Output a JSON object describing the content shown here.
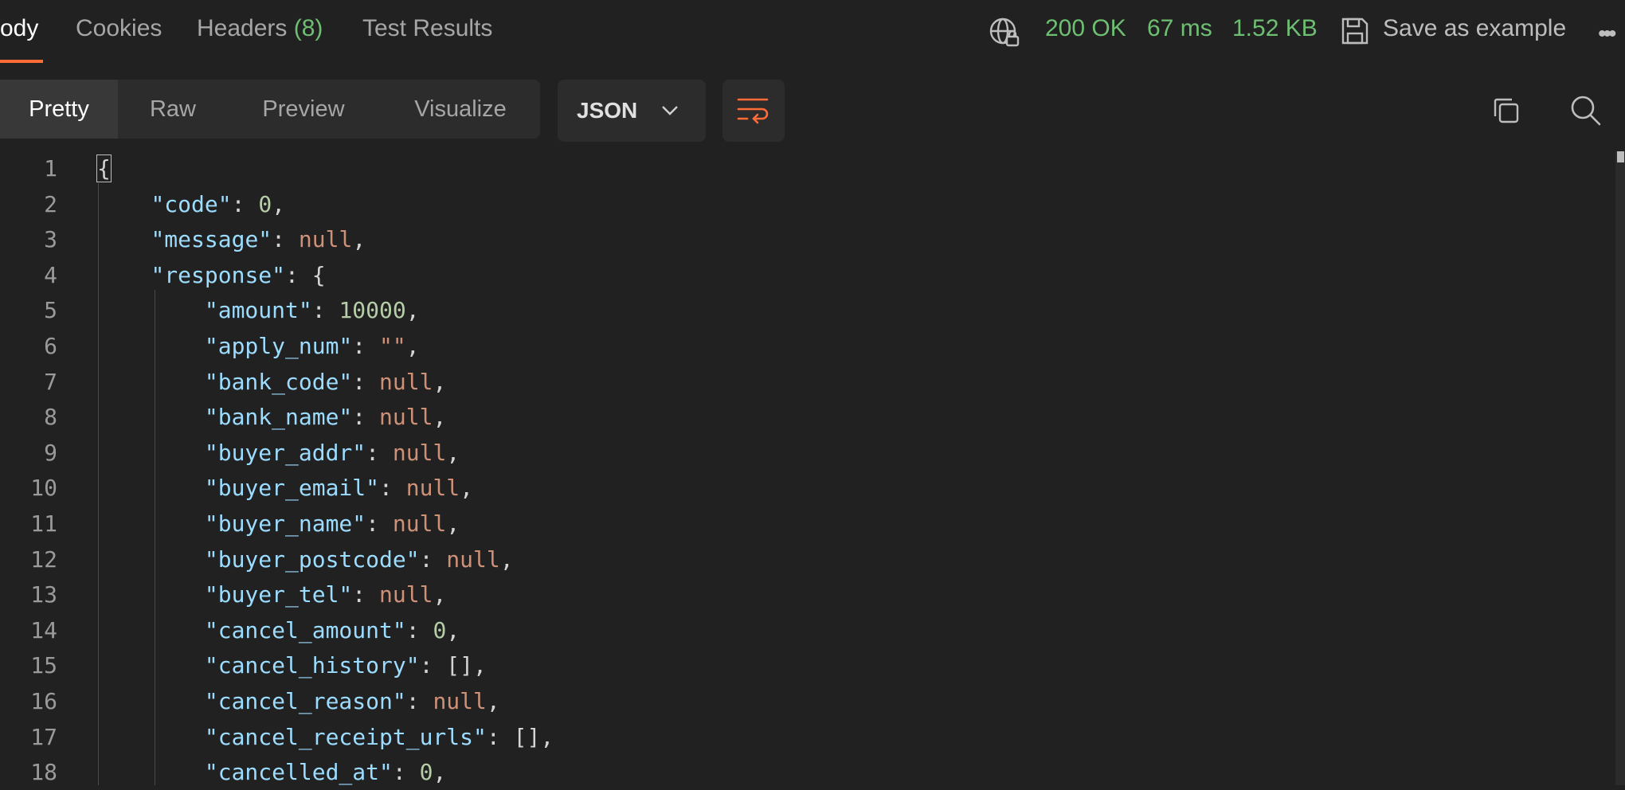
{
  "tabs": [
    {
      "label": "ody",
      "active": true
    },
    {
      "label": "Cookies"
    },
    {
      "label": "Headers",
      "count": "(8)"
    },
    {
      "label": "Test Results"
    }
  ],
  "status": {
    "code": "200 OK",
    "time": "67 ms",
    "size": "1.52 KB"
  },
  "save_example_label": "Save as example",
  "more_label": "•••",
  "view_modes": [
    "Pretty",
    "Raw",
    "Preview",
    "Visualize"
  ],
  "format": "JSON",
  "colors": {
    "accent": "#ff6c37",
    "status_green": "#6fbf73",
    "key": "#9cdcfe",
    "number": "#b5cea8",
    "null": "#ce9178"
  },
  "icons": [
    "globe-lock-icon",
    "save-icon",
    "wrap-lines-icon",
    "chevron-down-icon",
    "copy-icon",
    "search-icon"
  ],
  "code_lines": [
    {
      "n": "1",
      "t": "{"
    },
    {
      "n": "2",
      "key": "\"code\"",
      "val": "0",
      "type": "number",
      "tail": ","
    },
    {
      "n": "3",
      "key": "\"message\"",
      "val": "null",
      "type": "null",
      "tail": ","
    },
    {
      "n": "4",
      "key": "\"response\"",
      "val": "{",
      "type": "punct",
      "tail": ""
    },
    {
      "n": "5",
      "key": "\"amount\"",
      "val": "10000",
      "type": "number",
      "tail": ","
    },
    {
      "n": "6",
      "key": "\"apply_num\"",
      "val": "\"\"",
      "type": "string",
      "tail": ","
    },
    {
      "n": "7",
      "key": "\"bank_code\"",
      "val": "null",
      "type": "null",
      "tail": ","
    },
    {
      "n": "8",
      "key": "\"bank_name\"",
      "val": "null",
      "type": "null",
      "tail": ","
    },
    {
      "n": "9",
      "key": "\"buyer_addr\"",
      "val": "null",
      "type": "null",
      "tail": ","
    },
    {
      "n": "10",
      "key": "\"buyer_email\"",
      "val": "null",
      "type": "null",
      "tail": ","
    },
    {
      "n": "11",
      "key": "\"buyer_name\"",
      "val": "null",
      "type": "null",
      "tail": ","
    },
    {
      "n": "12",
      "key": "\"buyer_postcode\"",
      "val": "null",
      "type": "null",
      "tail": ","
    },
    {
      "n": "13",
      "key": "\"buyer_tel\"",
      "val": "null",
      "type": "null",
      "tail": ","
    },
    {
      "n": "14",
      "key": "\"cancel_amount\"",
      "val": "0",
      "type": "number",
      "tail": ","
    },
    {
      "n": "15",
      "key": "\"cancel_history\"",
      "val": "[]",
      "type": "punct",
      "tail": ","
    },
    {
      "n": "16",
      "key": "\"cancel_reason\"",
      "val": "null",
      "type": "null",
      "tail": ","
    },
    {
      "n": "17",
      "key": "\"cancel_receipt_urls\"",
      "val": "[]",
      "type": "punct",
      "tail": ","
    },
    {
      "n": "18",
      "key": "\"cancelled_at\"",
      "val": "0",
      "type": "number",
      "tail": ","
    }
  ]
}
